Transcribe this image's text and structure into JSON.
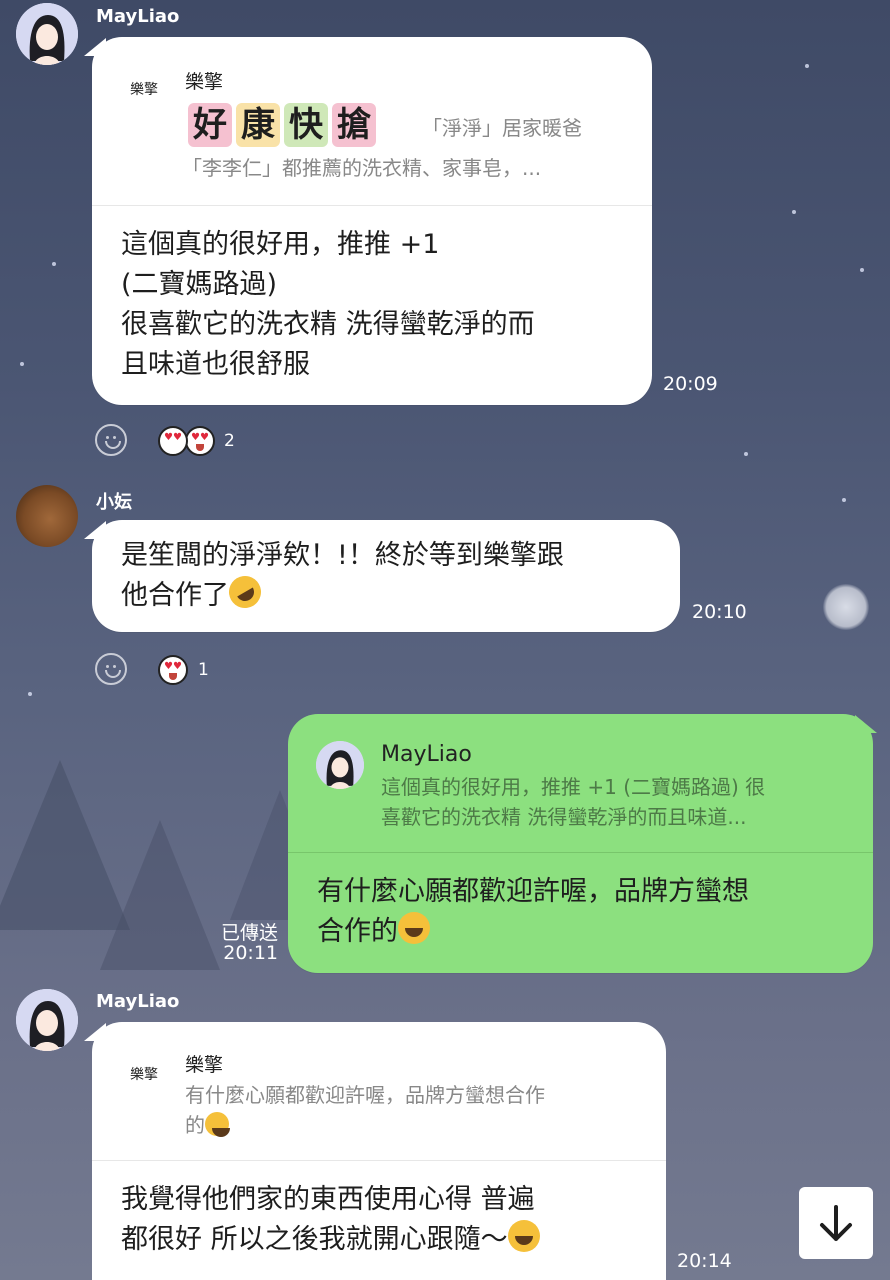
{
  "colors": {
    "bubble_in": "#ffffff",
    "bubble_out": "#8ce07f",
    "background": "#4b5673",
    "text": "#1e1e1e"
  },
  "messages": [
    {
      "sender": "MayLiao",
      "quote": {
        "logo": "樂擎",
        "name": "樂擎",
        "title_chars": [
          "好",
          "康",
          "快",
          "搶"
        ],
        "title_rest": "「淨淨」居家暖爸",
        "line2": "「李李仁」都推薦的洗衣精、家事皂，..."
      },
      "text": "這個真的很好用，推推 +1\n(二寶媽路過)\n很喜歡它的洗衣精 洗得蠻乾淨的而\n且味道也很舒服",
      "time": "20:09",
      "reaction_count": "2"
    },
    {
      "sender": "小妘",
      "text": "是笙闆的淨淨欸！!！終於等到樂擎跟\n他合作了",
      "time": "20:10",
      "reaction_count": "1"
    },
    {
      "quote": {
        "name": "MayLiao",
        "line1": "這個真的很好用，推推 +1 (二寶媽路過) 很",
        "line2": "喜歡它的洗衣精 洗得蠻乾淨的而且味道..."
      },
      "text": "有什麼心願都歡迎許喔，品牌方蠻想\n合作的",
      "read_label": "已傳送",
      "time": "20:11"
    },
    {
      "sender": "MayLiao",
      "quote": {
        "logo": "樂擎",
        "name": "樂擎",
        "line1": "有什麼心願都歡迎許喔，品牌方蠻想合作",
        "line2": "的"
      },
      "text": "我覺得他們家的東西使用心得 普遍\n都很好 所以之後我就開心跟隨～",
      "time": "20:14"
    }
  ],
  "icons": {
    "react": "smiley-outline-icon",
    "heart_eyes": "heart-eyes-emoji",
    "rofl": "rofl-emoji",
    "laugh": "tears-of-joy-emoji",
    "grin": "grinning-squint-emoji",
    "scroll": "arrow-down-icon"
  }
}
